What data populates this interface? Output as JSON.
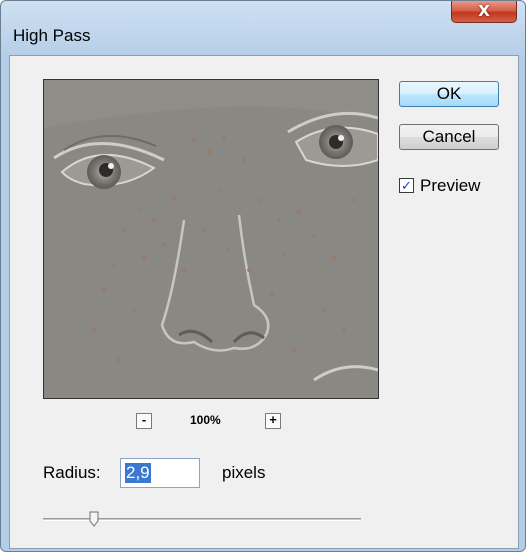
{
  "window": {
    "title": "High Pass",
    "close_glyph": "X"
  },
  "buttons": {
    "ok_label": "OK",
    "cancel_label": "Cancel"
  },
  "preview_option": {
    "label": "Preview",
    "checked": true,
    "check_glyph": "✓"
  },
  "zoom": {
    "level": "100%",
    "minus_label": "-",
    "plus_label": "+"
  },
  "radius": {
    "label": "Radius:",
    "value": "2,9",
    "unit": "pixels",
    "slider_level": 0.16
  },
  "colors": {
    "ok_accent": "#3c7fb1",
    "close_red": "#c2371e",
    "selection": "#3b78d2"
  },
  "icons": {
    "close": "close-icon",
    "checkbox": "check-icon",
    "slider": "slider-thumb"
  }
}
